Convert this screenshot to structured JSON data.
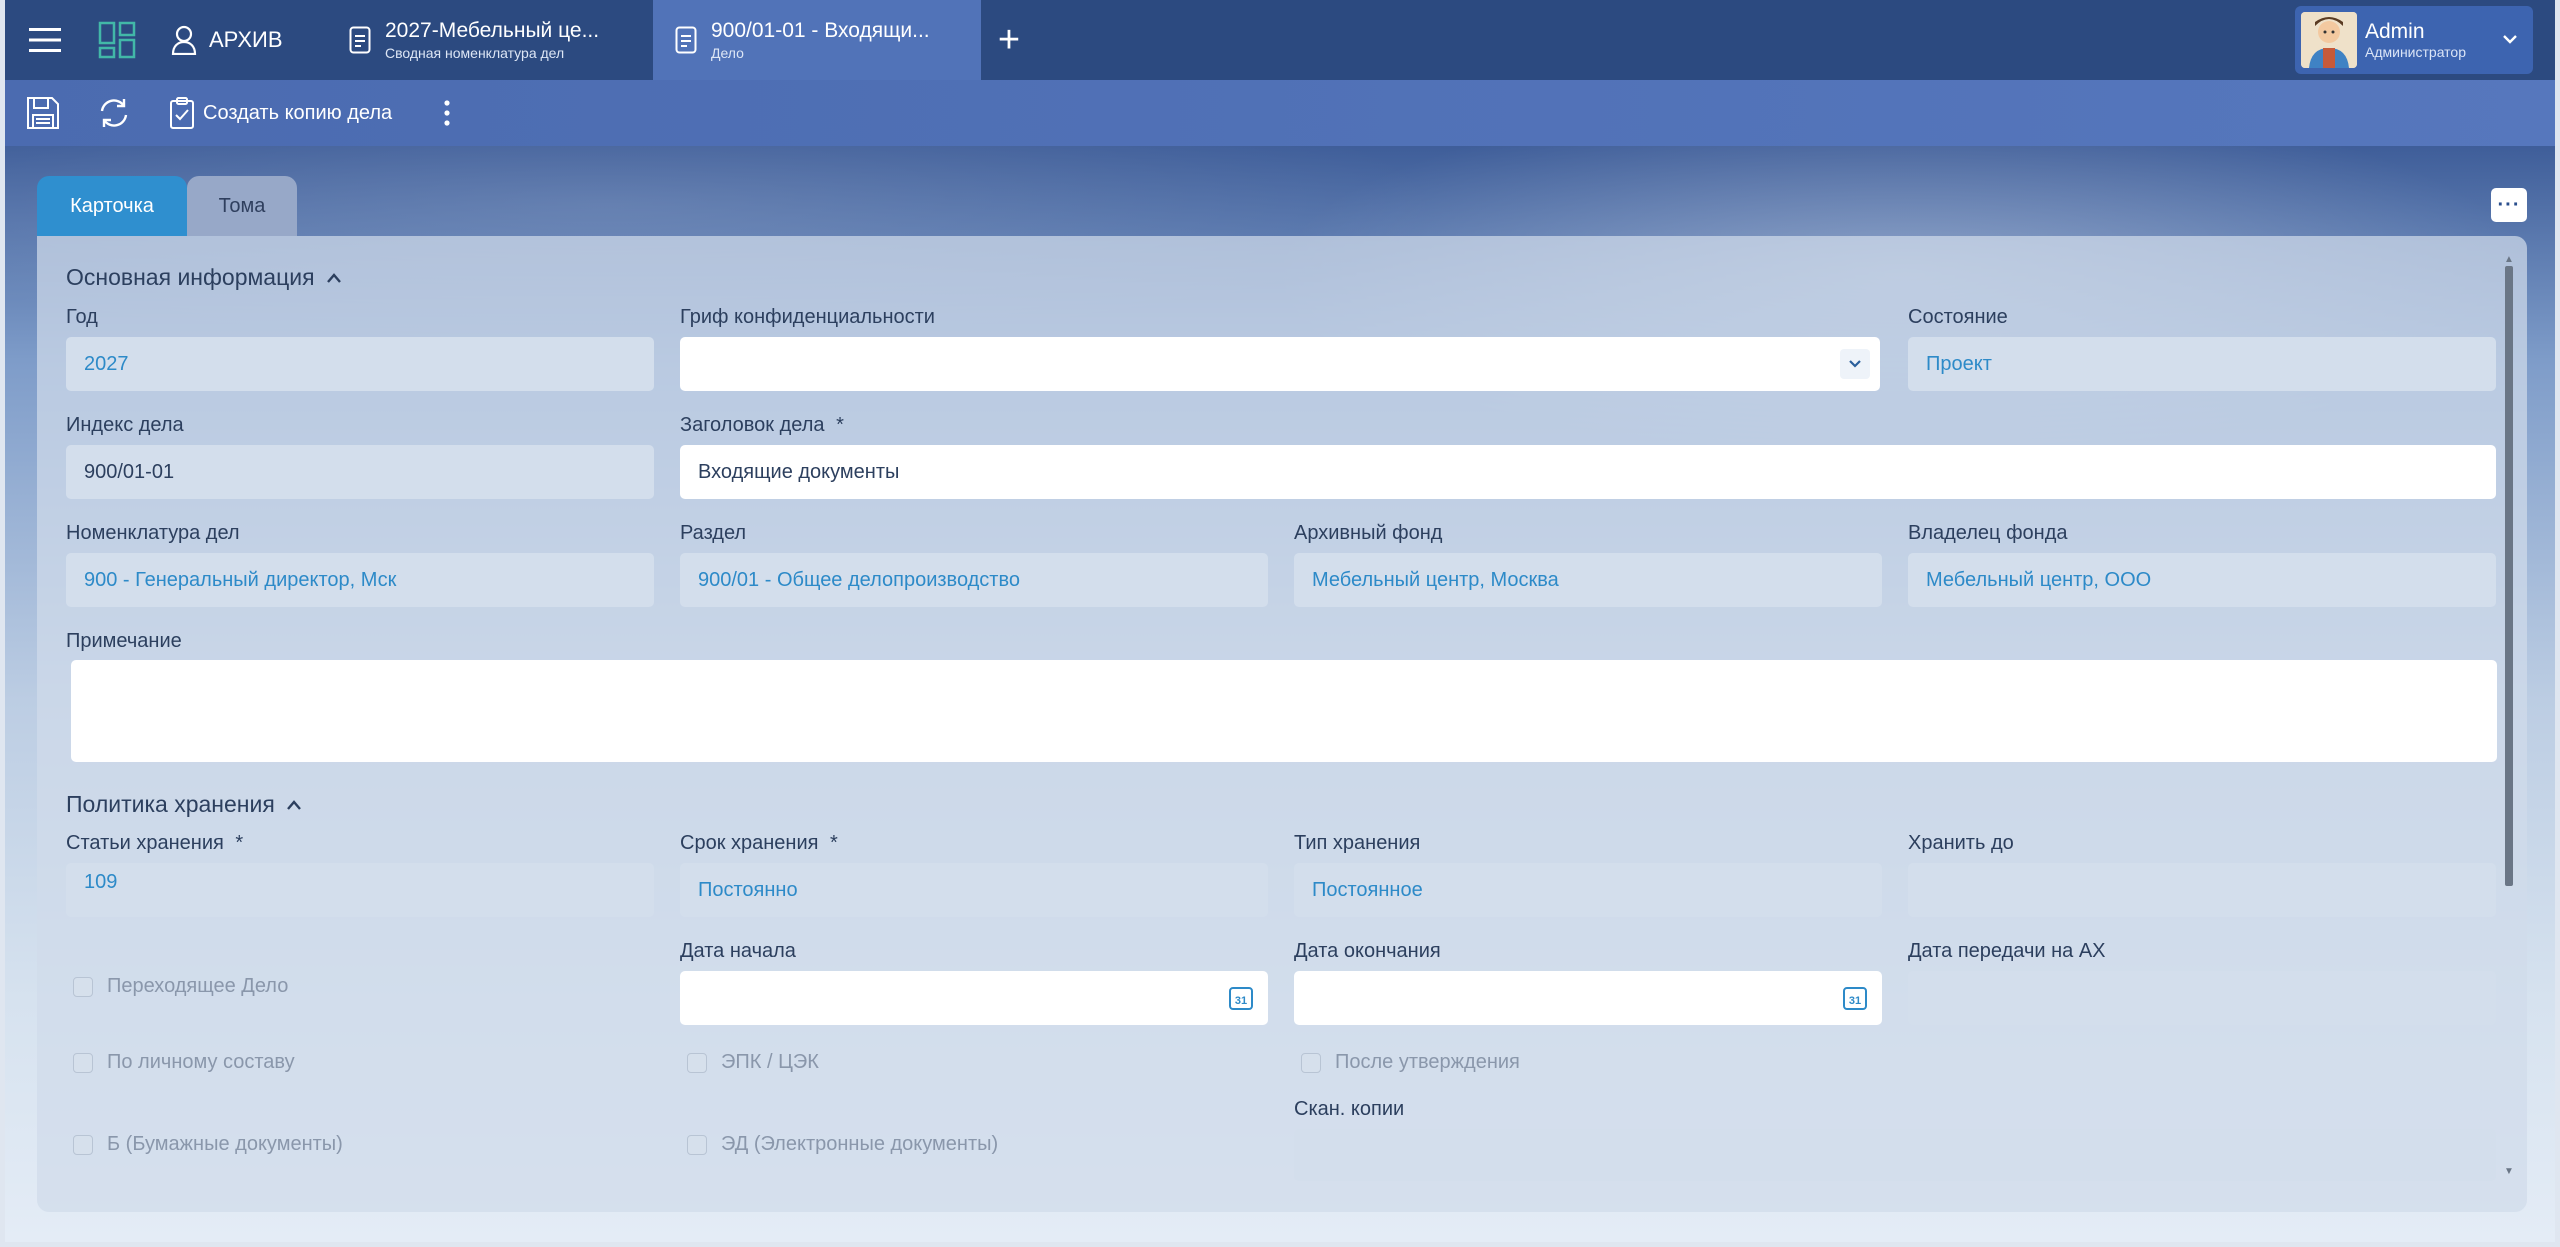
{
  "topbar": {
    "archive_label": "АРХИВ",
    "tabs": [
      {
        "title": "2027-Мебельный це...",
        "subtitle": "Сводная номенклатура дел"
      },
      {
        "title": "900/01-01 - Входящи...",
        "subtitle": "Дело"
      }
    ],
    "add_tab": "+",
    "user": {
      "name": "Admin",
      "role": "Администратор"
    }
  },
  "toolbar": {
    "copy_label": "Создать копию дела"
  },
  "content_tabs": {
    "card": "Карточка",
    "volumes": "Тома",
    "more": "···"
  },
  "main_info": {
    "title": "Основная информация",
    "year_label": "Год",
    "year_value": "2027",
    "secrecy_label": "Гриф конфиденциальности",
    "secrecy_value": "",
    "state_label": "Состояние",
    "state_value": "Проект",
    "index_label": "Индекс дела",
    "index_value": "900/01-01",
    "heading_label": "Заголовок дела",
    "heading_value": "Входящие документы",
    "nomenclature_label": "Номенклатура дел",
    "nomenclature_value": "900 - Генеральный директор, Мск",
    "section_label": "Раздел",
    "section_value": "900/01 - Общее делопроизводство",
    "fund_label": "Архивный фонд",
    "fund_value": "Мебельный центр, Москва",
    "owner_label": "Владелец фонда",
    "owner_value": "Мебельный центр, ООО",
    "note_label": "Примечание",
    "note_value": ""
  },
  "storage": {
    "title": "Политика хранения",
    "articles_label": "Статьи хранения",
    "articles_value": "109",
    "term_label": "Срок хранения",
    "term_value": "Постоянно",
    "type_label": "Тип хранения",
    "type_value": "Постоянное",
    "keep_until_label": "Хранить до",
    "keep_until_value": "",
    "start_date_label": "Дата начала",
    "end_date_label": "Дата окончания",
    "transfer_date_label": "Дата передачи на АХ",
    "scan_label": "Скан. копии",
    "checkboxes": {
      "transitional": "Переходящее Дело",
      "personnel": "По личному составу",
      "epk": "ЭПК / ЦЭК",
      "after_approval": "После утверждения",
      "paper": "Б (Бумажные документы)",
      "electronic": "ЭД (Электронные документы)"
    }
  },
  "icons": {
    "menu": "hamburger-menu-icon",
    "grid": "dashboard-grid-icon",
    "user": "user-outline-icon",
    "doc": "document-icon",
    "save": "save-icon",
    "refresh": "refresh-icon",
    "clipboard": "clipboard-check-icon",
    "more": "more-vertical-icon",
    "chevron": "chevron-down-icon",
    "calendar": "calendar-icon"
  },
  "colors": {
    "topbar": "#2c4a80",
    "toolbar": "#4b6bb0",
    "active_tab": "#2f8fcf",
    "link_value": "#2d8ac8"
  }
}
